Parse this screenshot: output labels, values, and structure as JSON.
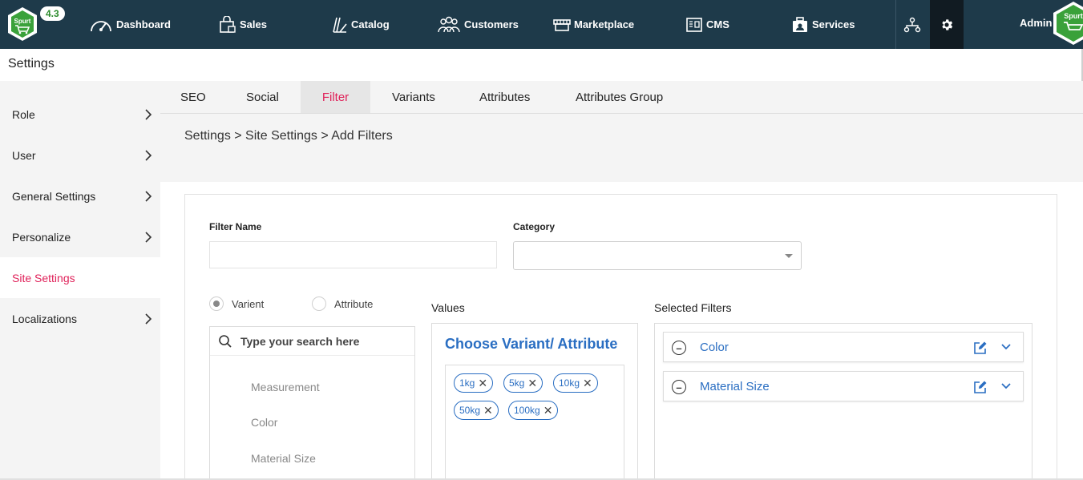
{
  "app": {
    "version": "4.3",
    "logo_text": "Spurt",
    "admin_label": "Admin",
    "avatar_text": "Spurt"
  },
  "nav": [
    {
      "label": "Dashboard",
      "icon": "speedometer-icon"
    },
    {
      "label": "Sales",
      "icon": "shopping-bag-icon"
    },
    {
      "label": "Catalog",
      "icon": "catalog-icon"
    },
    {
      "label": "Customers",
      "icon": "users-icon"
    },
    {
      "label": "Marketplace",
      "icon": "store-icon"
    },
    {
      "label": "CMS",
      "icon": "cms-icon"
    },
    {
      "label": "Services",
      "icon": "services-icon"
    }
  ],
  "page": {
    "title": "Settings",
    "breadcrumb": "Settings > Site Settings > Add Filters"
  },
  "sidebar": {
    "items": [
      {
        "label": "Role",
        "active": false
      },
      {
        "label": "User",
        "active": false
      },
      {
        "label": "General Settings",
        "active": false
      },
      {
        "label": "Personalize",
        "active": false
      },
      {
        "label": "Site Settings",
        "active": true
      },
      {
        "label": "Localizations",
        "active": false
      }
    ]
  },
  "tabs": [
    {
      "label": "SEO"
    },
    {
      "label": "Social"
    },
    {
      "label": "Filter",
      "active": true
    },
    {
      "label": "Variants"
    },
    {
      "label": "Attributes"
    },
    {
      "label": "Attributes Group"
    }
  ],
  "form": {
    "filter_name_label": "Filter Name",
    "filter_name_value": "",
    "category_label": "Category",
    "category_value": "",
    "radio_varient": "Varient",
    "radio_attribute": "Attribute",
    "selected_type": "Varient",
    "search_placeholder": "Type your search here",
    "options": [
      "Measurement",
      "Color",
      "Material Size"
    ],
    "values_label": "Values",
    "values_title": "Choose Variant/ Attribute",
    "chips": [
      "1kg",
      "5kg",
      "10kg",
      "50kg",
      "100kg"
    ],
    "selected_label": "Selected Filters",
    "selected_filters": [
      "Color",
      "Material Size"
    ]
  },
  "colors": {
    "topbar": "#1e3a4a",
    "accent": "#e0225a",
    "link_blue": "#2a6ec2"
  }
}
